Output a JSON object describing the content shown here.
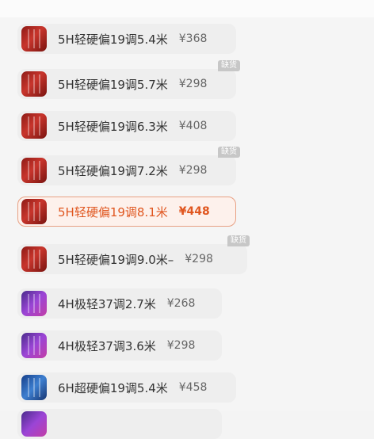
{
  "sku_list": {
    "items": [
      {
        "name": "5H轻硬偏19调5.4米",
        "price": "¥368",
        "thumb": "red",
        "selected": false,
        "badge": ""
      },
      {
        "name": "5H轻硬偏19调5.7米",
        "price": "¥298",
        "thumb": "red",
        "selected": false,
        "badge": "缺货"
      },
      {
        "name": "5H轻硬偏19调6.3米",
        "price": "¥408",
        "thumb": "red",
        "selected": false,
        "badge": ""
      },
      {
        "name": "5H轻硬偏19调7.2米",
        "price": "¥298",
        "thumb": "red",
        "selected": false,
        "badge": "缺货"
      },
      {
        "name": "5H轻硬偏19调8.1米",
        "price": "¥448",
        "thumb": "red",
        "selected": true,
        "badge": ""
      },
      {
        "name": "5H轻硬偏19调9.0米–",
        "price": "¥298",
        "thumb": "red",
        "selected": false,
        "badge": "缺货"
      },
      {
        "name": "4H极轻37调2.7米",
        "price": "¥268",
        "thumb": "purple",
        "selected": false,
        "badge": ""
      },
      {
        "name": "4H极轻37调3.6米",
        "price": "¥298",
        "thumb": "purple",
        "selected": false,
        "badge": ""
      },
      {
        "name": "6H超硬偏19调5.4米",
        "price": "¥458",
        "thumb": "blue",
        "selected": false,
        "badge": ""
      }
    ]
  },
  "colors": {
    "selected_accent": "#e0561f",
    "selected_border": "#e8a184",
    "item_bg": "#eeeeee",
    "badge_bg": "#c7c7c7"
  },
  "icons": {
    "thumb": "fishing-rod-thumbnail-icon"
  }
}
